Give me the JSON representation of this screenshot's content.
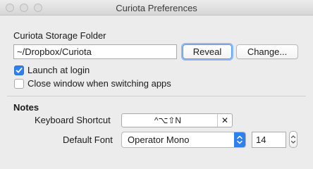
{
  "window": {
    "title": "Curiota Preferences"
  },
  "storage": {
    "label": "Curiota Storage Folder",
    "path": "~/Dropbox/Curiota",
    "reveal_label": "Reveal",
    "change_label": "Change..."
  },
  "options": [
    {
      "label": "Launch at login",
      "checked": true
    },
    {
      "label": "Close window when switching apps",
      "checked": false
    }
  ],
  "notes": {
    "heading": "Notes",
    "shortcut_label": "Keyboard Shortcut",
    "shortcut_value": "^⌥⇧N",
    "shortcut_clear": "✕",
    "font_label": "Default Font",
    "font_value": "Operator Mono",
    "font_size": "14"
  },
  "colors": {
    "accent": "#2f80ed",
    "window_bg": "#ececec"
  },
  "icons": {
    "popup_arrows": "chevron-up-down-icon",
    "stepper": "stepper-up-down-icon",
    "clear_shortcut": "close-icon",
    "checkmark": "checkmark-icon"
  }
}
